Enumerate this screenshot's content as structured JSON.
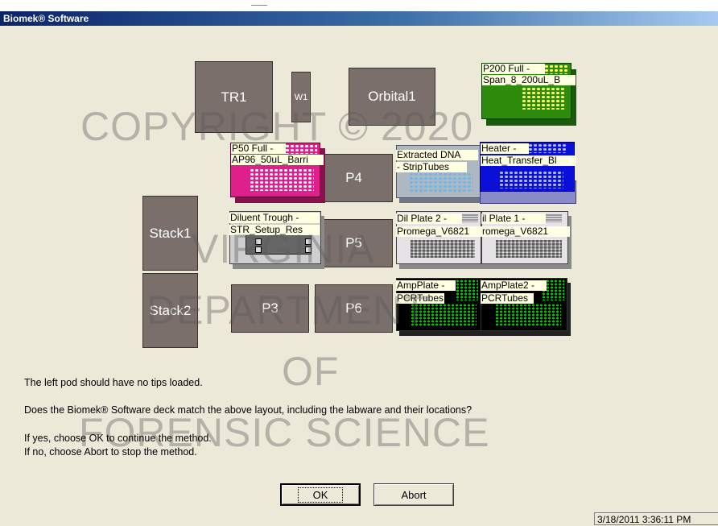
{
  "window": {
    "title": "Biomek® Software"
  },
  "deck": {
    "positions": {
      "tr1": "TR1",
      "w1": "W1",
      "orbital1": "Orbital1",
      "stack1": "Stack1",
      "stack2": "Stack2",
      "p3": "P3",
      "p4": "P4",
      "p5": "P5",
      "p6": "P6"
    },
    "labware": {
      "p200": [
        "P200 Full -",
        "Span_8_200uL_B"
      ],
      "p50": [
        "P50 Full -",
        "AP96_50uL_Barri"
      ],
      "extracted": [
        "Extracted DNA",
        "- StripTubes"
      ],
      "heater": [
        "Heater -",
        "Heat_Transfer_Bl"
      ],
      "diluent": [
        "Diluent Trough -",
        "STR_Setup_Res"
      ],
      "dil2": [
        "Dil Plate 2 -",
        "Promega_V6821"
      ],
      "dil1": [
        "il Plate 1 -",
        "romega_V6821"
      ],
      "amp1": [
        "AmpPlate -",
        "PCRTubes"
      ],
      "amp2": [
        "AmpPlate2 -",
        "PCRTubes"
      ]
    },
    "colors": {
      "position": "#7b6f6b",
      "p200": "#2e8b0c",
      "p50": "#e0208a",
      "extracted": "#aeb8c2",
      "heater": "#0a10d8",
      "dilplate": "#d8d4d8",
      "amp": "#000000",
      "tipdot": "#ffff66",
      "ampdot": "#00c000",
      "bluedot": "#6fb7e6"
    }
  },
  "watermark": [
    "COPYRIGHT © 2020",
    "VIRGINIA",
    "DEPARTMENT",
    "OF",
    "FORENSIC SCIENCE"
  ],
  "message": {
    "line1": "The left pod should have no tips loaded.",
    "line2": "Does the Biomek® Software deck match the above layout, including the labware and their locations?",
    "line3": "If yes, choose OK to continue the method.",
    "line4": "If no, choose Abort to stop the method."
  },
  "buttons": {
    "ok": "OK",
    "abort": "Abort"
  },
  "status": {
    "timestamp": "3/18/2011 3:36:11 PM"
  }
}
